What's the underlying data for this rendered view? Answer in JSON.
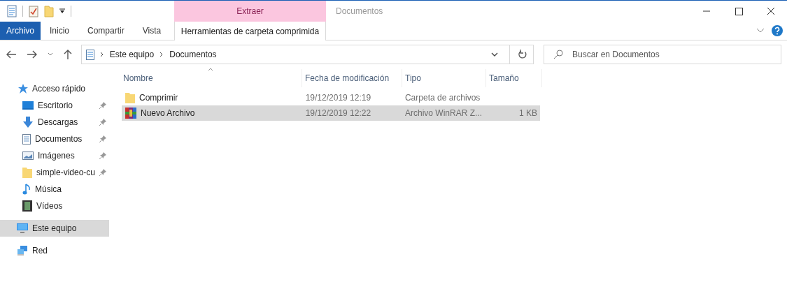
{
  "window": {
    "title": "Documentos"
  },
  "context_tab": {
    "group": "Extraer",
    "label": "Herramientas de carpeta comprimida",
    "selected": true
  },
  "ribbon_tabs": [
    {
      "label": "Archivo",
      "kind": "file"
    },
    {
      "label": "Inicio",
      "kind": "tab"
    },
    {
      "label": "Compartir",
      "kind": "tab"
    },
    {
      "label": "Vista",
      "kind": "tab"
    }
  ],
  "address": {
    "path": [
      "Este equipo",
      "Documentos"
    ]
  },
  "search": {
    "placeholder": "Buscar en Documentos"
  },
  "sidebar": {
    "sections": [
      {
        "label": "Acceso rápido",
        "kind": "star",
        "selected": false,
        "children": [
          {
            "label": "Escritorio",
            "kind": "desktop",
            "pinned": true,
            "selected": false
          },
          {
            "label": "Descargas",
            "kind": "download",
            "pinned": true,
            "selected": false
          },
          {
            "label": "Documentos",
            "kind": "document",
            "pinned": true,
            "selected": false
          },
          {
            "label": "Imágenes",
            "kind": "image",
            "pinned": true,
            "selected": false
          },
          {
            "label": "simple-video-cu",
            "kind": "folder",
            "pinned": true,
            "selected": false
          },
          {
            "label": "Música",
            "kind": "music",
            "pinned": false,
            "selected": false
          },
          {
            "label": "Vídeos",
            "kind": "video",
            "pinned": false,
            "selected": false
          }
        ]
      },
      {
        "label": "Este equipo",
        "kind": "computer",
        "selected": true
      },
      {
        "label": "Red",
        "kind": "network",
        "selected": false
      }
    ]
  },
  "table": {
    "columns": [
      "Nombre",
      "Fecha de modificación",
      "Tipo",
      "Tamaño"
    ],
    "rows": [
      {
        "kind": "folder",
        "name": "Comprimir",
        "date": "19/12/2019 12:19",
        "type": "Carpeta de archivos",
        "size": "",
        "selected": false
      },
      {
        "kind": "archive",
        "name": "Nuevo Archivo",
        "date": "19/12/2019 12:22",
        "type": "Archivo WinRAR Z...",
        "size": "1 KB",
        "selected": true
      }
    ]
  }
}
